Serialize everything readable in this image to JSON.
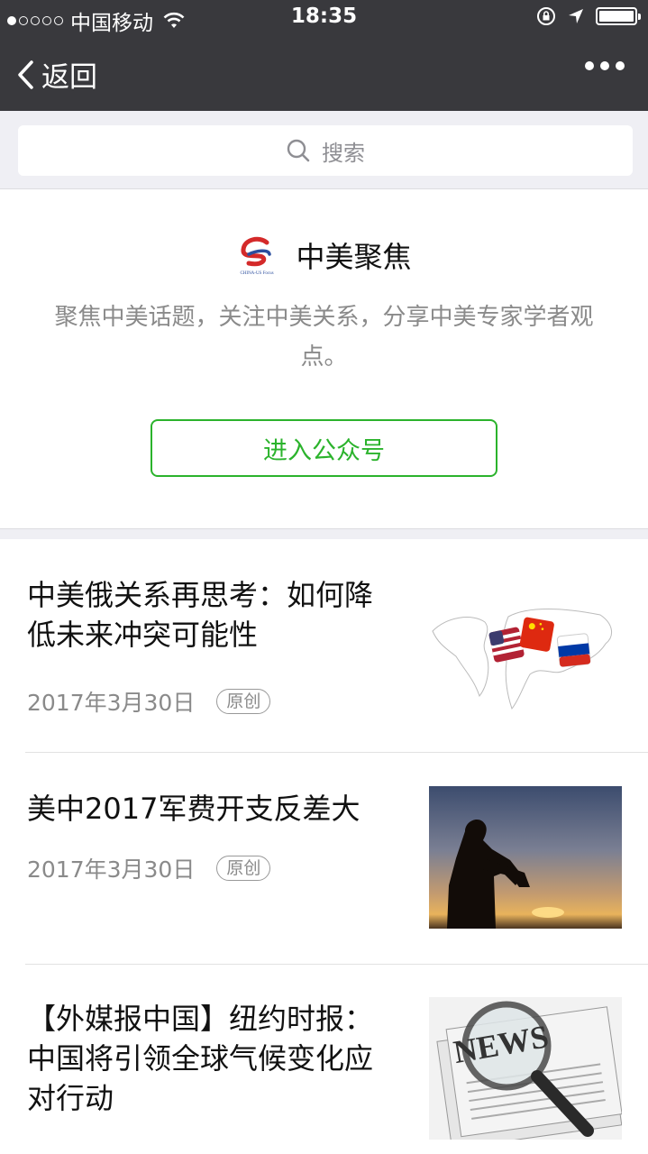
{
  "status_bar": {
    "carrier": "中国移动",
    "time": "18:35"
  },
  "nav": {
    "back_label": "返回"
  },
  "search": {
    "placeholder": "搜索"
  },
  "account": {
    "name": "中美聚焦",
    "logo_text": "CHINA-US Focus",
    "description": "聚焦中美话题，关注中美关系，分享中美专家学者观点。",
    "enter_label": "进入公众号"
  },
  "articles": [
    {
      "title": "中美俄关系再思考：如何降低未来冲突可能性",
      "date": "2017年3月30日",
      "tag": "原创"
    },
    {
      "title": "美中2017军费开支反差大",
      "date": "2017年3月30日",
      "tag": "原创"
    },
    {
      "title": "【外媒报中国】纽约时报：中国将引领全球气候变化应对行动"
    }
  ],
  "colors": {
    "accent": "#2bb32c",
    "nav_bg": "#39393d"
  }
}
